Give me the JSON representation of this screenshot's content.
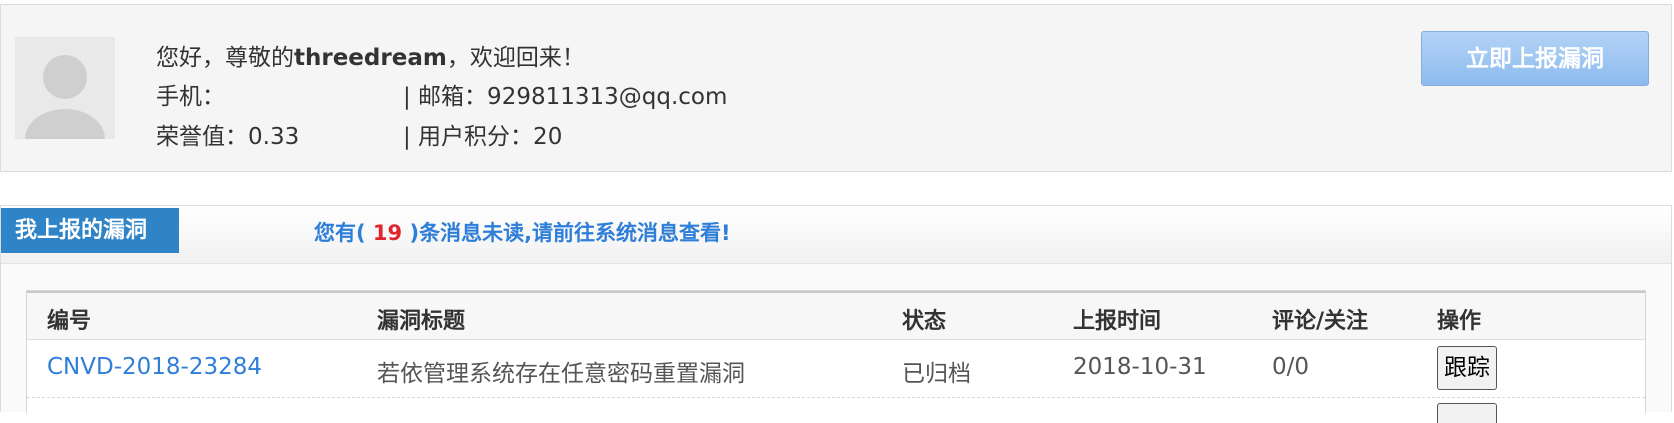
{
  "profile": {
    "greeting_prefix": "您好，尊敬的",
    "username": "threedream",
    "greeting_suffix": "，欢迎回来！",
    "phone_label": "手机：",
    "phone_value": "",
    "email_label": "| 邮箱：929811313@qq.com",
    "honor_label": "荣誉值：0.33",
    "points_label": "| 用户积分：20",
    "report_button": "立即上报漏洞"
  },
  "section": {
    "tab_label": "我上报的漏洞",
    "unread_prefix": "您有(",
    "unread_count": "19",
    "unread_suffix": ")条消息未读,请前往系统消息查看!"
  },
  "table": {
    "headers": [
      "编号",
      "漏洞标题",
      "状态",
      "上报时间",
      "评论/关注",
      "操作"
    ],
    "rows": [
      {
        "id": "CNVD-2018-23284",
        "title": "若依管理系统存在任意密码重置漏洞",
        "status": "已归档",
        "date": "2018-10-31",
        "comments": "0/0",
        "action": "跟踪"
      }
    ]
  },
  "colors": {
    "accent": "#2f83c7",
    "link": "#2f7ed8",
    "count": "#e0262d"
  }
}
